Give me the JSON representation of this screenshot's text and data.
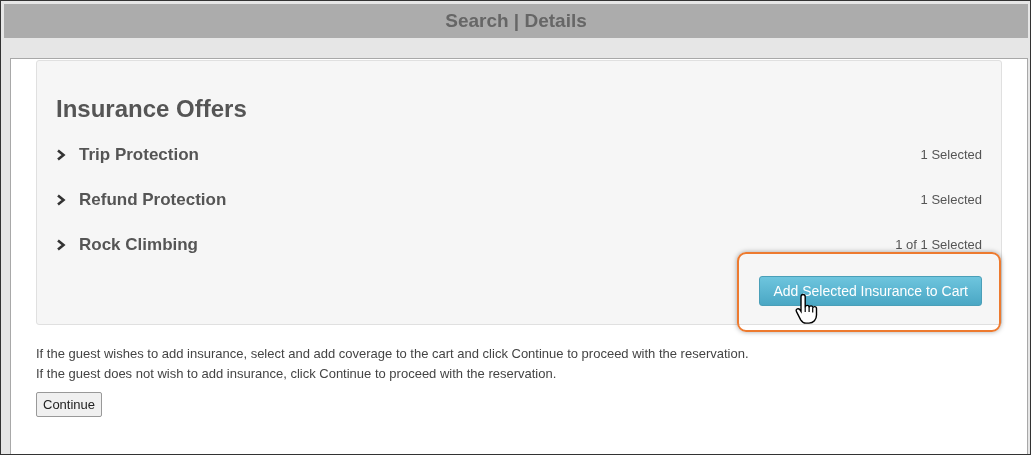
{
  "header": {
    "title": "Search | Details"
  },
  "offers": {
    "title": "Insurance Offers",
    "items": [
      {
        "name": "Trip Protection",
        "status": "1 Selected",
        "expanded": false
      },
      {
        "name": "Refund Protection",
        "status": "1 Selected",
        "expanded": false
      },
      {
        "name": "Rock Climbing",
        "status": "1 of 1 Selected",
        "expanded": false
      }
    ],
    "add_button": {
      "label": "Add Selected Insurance to Cart",
      "highlighted": true
    }
  },
  "instructions": [
    "If the guest wishes to add insurance, select and add coverage to the cart and click Continue to proceed with the reservation.",
    "If the guest does not wish to add insurance, click Continue to proceed with the reservation."
  ],
  "continue_button": {
    "label": "Continue"
  }
}
